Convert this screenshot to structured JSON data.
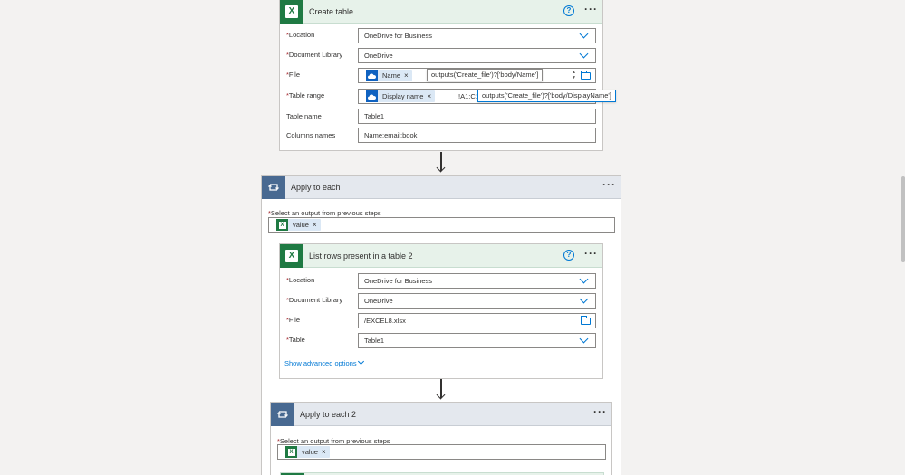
{
  "create_table": {
    "title": "Create table",
    "fields": {
      "location": {
        "label": "Location",
        "value": "OneDrive for Business"
      },
      "document_library": {
        "label": "Document Library",
        "value": "OneDrive"
      },
      "file": {
        "label": "File",
        "token": "Name",
        "expression": "outputs('Create_file')?['body/Name']"
      },
      "table_range": {
        "label": "Table range",
        "token": "Display name",
        "suffix": "!A1:C1",
        "expression": "outputs('Create_file')?['body/DisplayName']"
      },
      "table_name": {
        "label": "Table name",
        "value": "Table1"
      },
      "columns_names": {
        "label": "Columns names",
        "value": "Name;email;book"
      }
    }
  },
  "apply_to_each": {
    "title": "Apply to each",
    "select_label": "Select an output from previous steps",
    "token": "value"
  },
  "list_rows": {
    "title": "List rows present in a table 2",
    "fields": {
      "location": {
        "label": "Location",
        "value": "OneDrive for Business"
      },
      "document_library": {
        "label": "Document Library",
        "value": "OneDrive"
      },
      "file": {
        "label": "File",
        "value": "/EXCEL8.xlsx"
      },
      "table": {
        "label": "Table",
        "value": "Table1"
      }
    },
    "advanced_link": "Show advanced options"
  },
  "apply_to_each_2": {
    "title": "Apply to each 2",
    "select_label": "Select an output from previous steps",
    "token": "value"
  },
  "common": {
    "required_mark": "*",
    "remove_mark": "×",
    "more_menu": "···",
    "help_mark": "?",
    "excel_glyph": "X"
  },
  "colors": {
    "excel_green": "#1f7a43",
    "loop_blue": "#486991",
    "onedrive_blue": "#0f62c1",
    "accent": "#0078d4"
  }
}
